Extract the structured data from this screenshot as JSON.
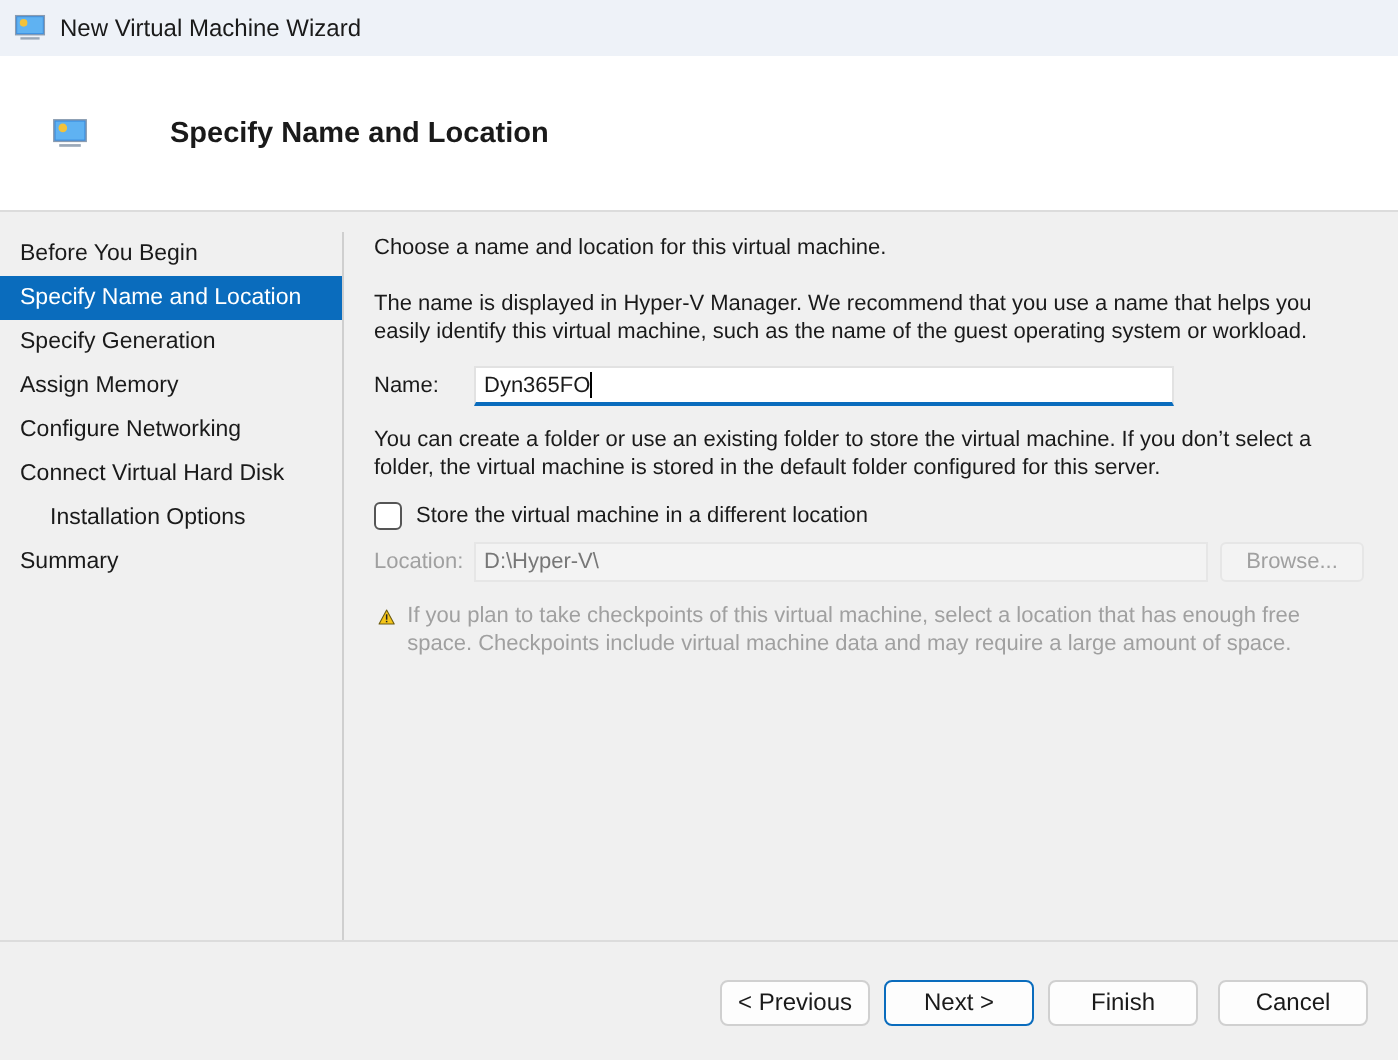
{
  "window": {
    "title": "New Virtual Machine Wizard"
  },
  "header": {
    "title": "Specify Name and Location"
  },
  "steps": [
    {
      "label": "Before You Begin",
      "selected": false
    },
    {
      "label": "Specify Name and Location",
      "selected": true
    },
    {
      "label": "Specify Generation",
      "selected": false
    },
    {
      "label": "Assign Memory",
      "selected": false
    },
    {
      "label": "Configure Networking",
      "selected": false
    },
    {
      "label": "Connect Virtual Hard Disk",
      "selected": false,
      "children": [
        {
          "label": "Installation Options",
          "selected": false
        }
      ]
    },
    {
      "label": "Summary",
      "selected": false
    }
  ],
  "content": {
    "intro": "Choose a name and location for this virtual machine.",
    "name_help": "The name is displayed in Hyper-V Manager. We recommend that you use a name that helps you easily identify this virtual machine, such as the name of the guest operating system or workload.",
    "name_field": {
      "label": "Name:",
      "value": "Dyn365FO"
    },
    "folder_help": "You can create a folder or use an existing folder to store the virtual machine. If you don’t select a folder, the virtual machine is stored in the default folder configured for this server.",
    "different_location": {
      "label": "Store the virtual machine in a different location",
      "checked": false
    },
    "location_field": {
      "label": "Location:",
      "value": "D:\\Hyper-V\\",
      "disabled": true
    },
    "browse_button": {
      "label": "Browse...",
      "disabled": true
    },
    "warning": "If you plan to take checkpoints of this virtual machine, select a location that has enough free space. Checkpoints include virtual machine data and may require a large amount of space."
  },
  "buttons": [
    {
      "label": "< Previous",
      "default": false
    },
    {
      "label": "Next >",
      "default": true
    },
    {
      "label": "Finish",
      "default": false
    },
    {
      "label": "Cancel",
      "default": false
    }
  ]
}
